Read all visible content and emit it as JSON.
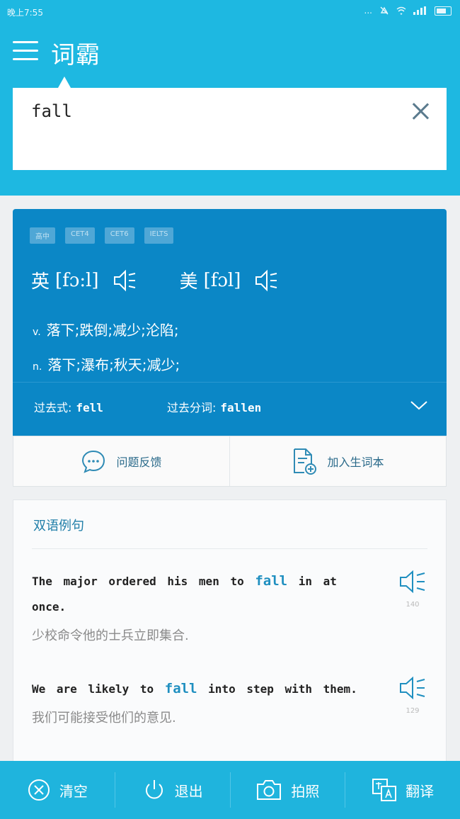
{
  "status_bar": {
    "time": "晚上7:55",
    "signal": "...",
    "battery": ""
  },
  "header": {
    "title": "词霸"
  },
  "search": {
    "value": "fall",
    "placeholder": ""
  },
  "definition": {
    "tags": [
      "高中",
      "CET4",
      "CET6",
      "IELTS"
    ],
    "pron_uk_label": "英",
    "pron_uk": "[fɔ:l]",
    "pron_us_label": "美",
    "pron_us": "[fɔl]",
    "senses": [
      {
        "pos": "v.",
        "text": "落下;跌倒;减少;沦陷;"
      },
      {
        "pos": "n.",
        "text": "落下;瀑布;秋天;减少;"
      }
    ],
    "forms": [
      {
        "label": "过去式:",
        "value": "fell"
      },
      {
        "label": "过去分词:",
        "value": "fallen"
      }
    ]
  },
  "actions": {
    "feedback": "问题反馈",
    "add_wordbook": "加入生词本"
  },
  "examples": {
    "title": "双语例句",
    "items": [
      {
        "en_before": "The major ordered his men to ",
        "en_keyword": "fall",
        "en_after": " in at once.",
        "cn": "少校命令他的士兵立即集合.",
        "count": "140"
      },
      {
        "en_before": "We are likely to ",
        "en_keyword": "fall",
        "en_after": " into step with them.",
        "cn": "我们可能接受他们的意见.",
        "count": "129"
      }
    ]
  },
  "bottom_bar": {
    "clear": "清空",
    "exit": "退出",
    "photo": "拍照",
    "translate": "翻译"
  },
  "colors": {
    "primary": "#1eb8e1",
    "card": "#0b87c6",
    "accent": "#1f8fc0"
  }
}
